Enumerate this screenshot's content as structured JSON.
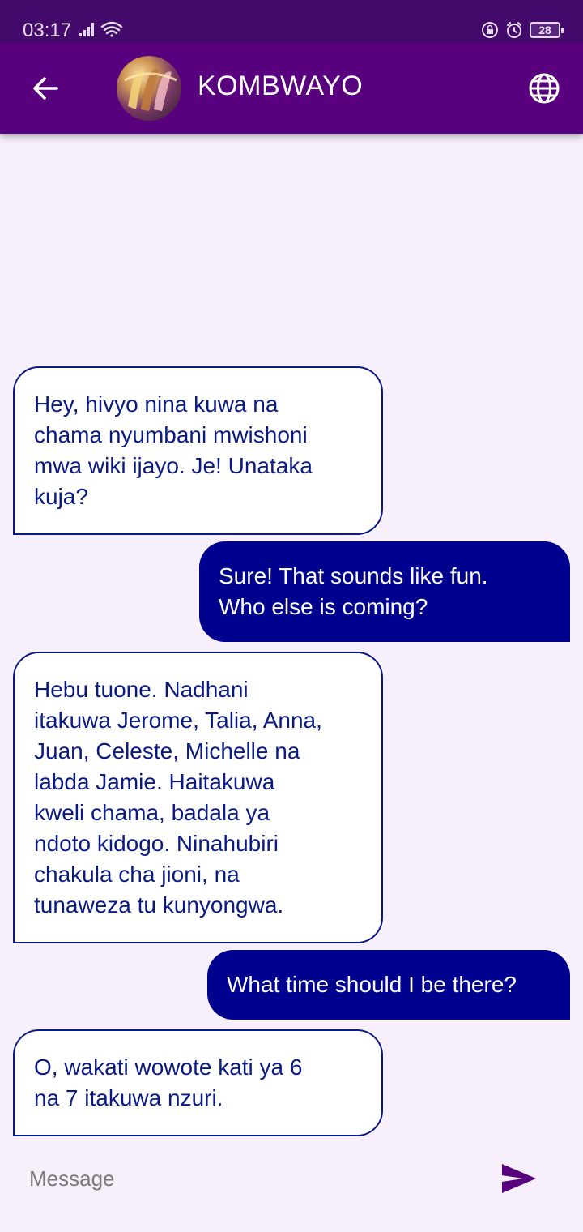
{
  "status_bar": {
    "time": "03:17",
    "battery": "28",
    "icons": [
      "signal-icon",
      "wifi-icon",
      "lock-rotate-icon",
      "alarm-icon",
      "battery-icon"
    ]
  },
  "header": {
    "title": "KOMBWAYO",
    "back_icon": "arrow-left-icon",
    "language_icon": "globe-icon",
    "colors": {
      "bar": "#58007e",
      "status": "#430a6b"
    }
  },
  "messages": [
    {
      "side": "incoming",
      "lines": [
        "Hey, hivyo nina kuwa na",
        "chama nyumbani mwishoni",
        "mwa wiki ijayo. Je! Unataka",
        "kuja?"
      ]
    },
    {
      "side": "outgoing",
      "lines": [
        "Sure! That sounds like fun.",
        "Who else is coming?"
      ]
    },
    {
      "side": "incoming",
      "lines": [
        "Hebu tuone. Nadhani",
        "itakuwa Jerome, Talia, Anna,",
        "Juan, Celeste, Michelle na",
        "labda Jamie. Haitakuwa",
        "kweli chama, badala ya",
        "ndoto kidogo. Ninahubiri",
        "chakula cha jioni, na",
        "tunaweza tu kunyongwa."
      ]
    },
    {
      "side": "outgoing",
      "lines": [
        "What time should I be there?"
      ]
    },
    {
      "side": "incoming",
      "lines": [
        "O, wakati wowote kati ya 6",
        "na 7 itakuwa nzuri."
      ]
    }
  ],
  "composer": {
    "placeholder": "Message",
    "value": "",
    "send_icon": "send-icon",
    "send_color": "#58007e"
  }
}
